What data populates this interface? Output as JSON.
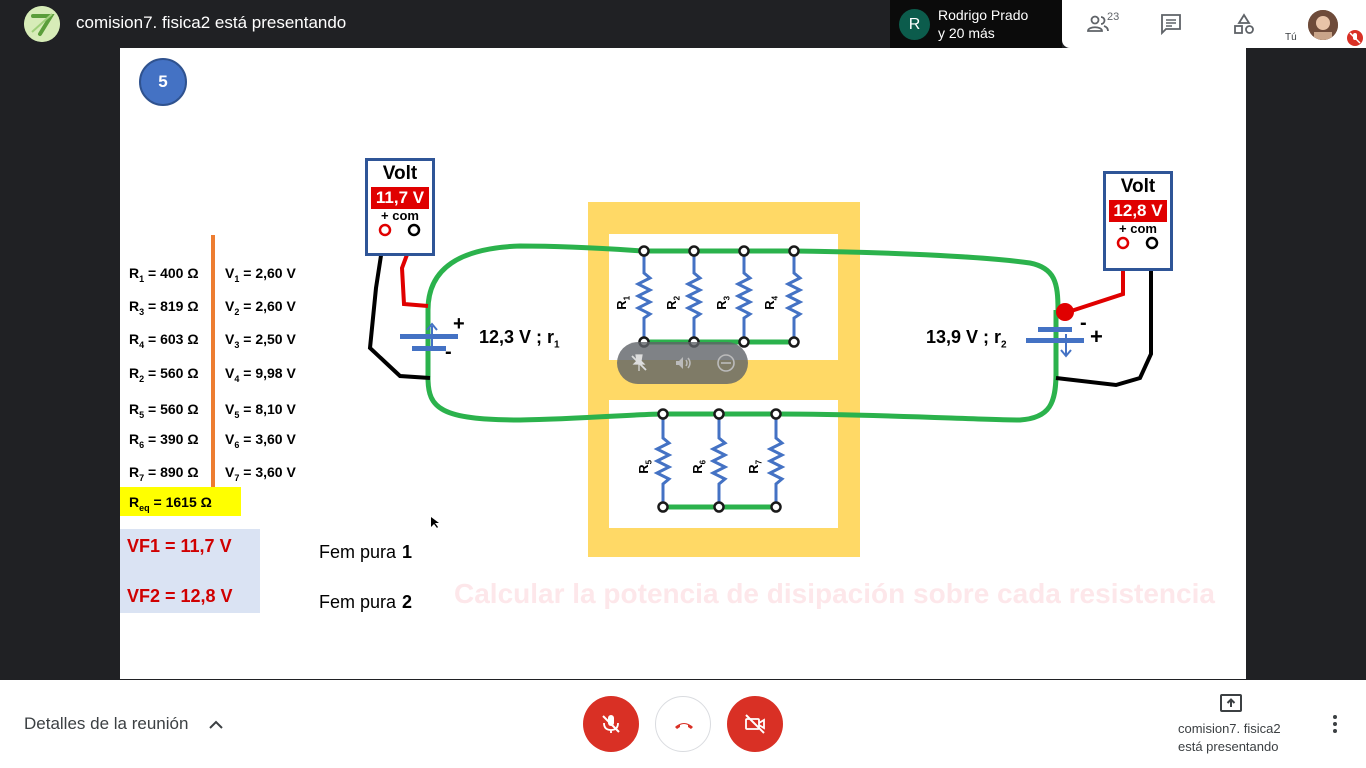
{
  "header": {
    "title": "comision7. fisica2 está presentando",
    "participant_initial": "R",
    "participant_name": "Rodrigo Prado",
    "participant_more": "y 20 más",
    "people_count": "23",
    "self_label": "Tú"
  },
  "slide": {
    "number": "5",
    "resistances": [
      {
        "name": "R",
        "sub": "1",
        "value": "= 400 Ω"
      },
      {
        "name": "R",
        "sub": "3",
        "value": "= 819 Ω"
      },
      {
        "name": "R",
        "sub": "4",
        "value": "= 603 Ω"
      },
      {
        "name": "R",
        "sub": "2",
        "value": "= 560 Ω"
      },
      {
        "name": "R",
        "sub": "5",
        "value": "= 560 Ω"
      },
      {
        "name": "R",
        "sub": "6",
        "value": "= 390 Ω"
      },
      {
        "name": "R",
        "sub": "7",
        "value": "= 890 Ω"
      }
    ],
    "voltages": [
      {
        "name": "V",
        "sub": "1",
        "value": "=  2,60 V"
      },
      {
        "name": "V",
        "sub": "2",
        "value": "=  2,60 V"
      },
      {
        "name": "V",
        "sub": "3",
        "value": "=  2,50 V"
      },
      {
        "name": "V",
        "sub": "4",
        "value": "=  9,98 V"
      },
      {
        "name": "V",
        "sub": "5",
        "value": "=  8,10 V"
      },
      {
        "name": "V",
        "sub": "6",
        "value": "=  3,60 V"
      },
      {
        "name": "V",
        "sub": "7",
        "value": "=  3,60 V"
      }
    ],
    "req": {
      "name": "R",
      "sub": "eq",
      "value": " = 1615 Ω"
    },
    "vf1": "VF1  =  11,7 V",
    "vf2": "VF2  =  12,8 V",
    "fem1_text": "Fem pura",
    "fem1_num": "1",
    "fem2_text": "Fem pura",
    "fem2_num": "2",
    "task": "Calcular la potencia de disipación sobre cada resistencia",
    "meter1": {
      "title": "Volt",
      "value": "11,7 V",
      "terms": "+  com"
    },
    "meter2": {
      "title": "Volt",
      "value": "12,8 V",
      "terms": "+  com"
    },
    "emf1": {
      "text": "12,3 V ;  r",
      "sub": "1",
      "plus": "+",
      "minus": "-"
    },
    "emf2": {
      "text": "13,9 V  ;  r",
      "sub": "2",
      "plus": "+",
      "minus": "-"
    },
    "resistor_labels": [
      {
        "name": "R",
        "sub": "1"
      },
      {
        "name": "R",
        "sub": "2"
      },
      {
        "name": "R",
        "sub": "3"
      },
      {
        "name": "R",
        "sub": "4"
      },
      {
        "name": "R",
        "sub": "5"
      },
      {
        "name": "R",
        "sub": "6"
      },
      {
        "name": "R",
        "sub": "7"
      }
    ]
  },
  "bottom": {
    "details": "Detalles de la reunión",
    "present_line1": "comision7. fisica2",
    "present_line2": "está presentando"
  },
  "colors": {
    "wire_green": "#2bb24c",
    "yellow_box": "#ffd966",
    "resistor_blue": "#4472c4",
    "meter_red": "#e00000",
    "danger": "#d93025"
  }
}
